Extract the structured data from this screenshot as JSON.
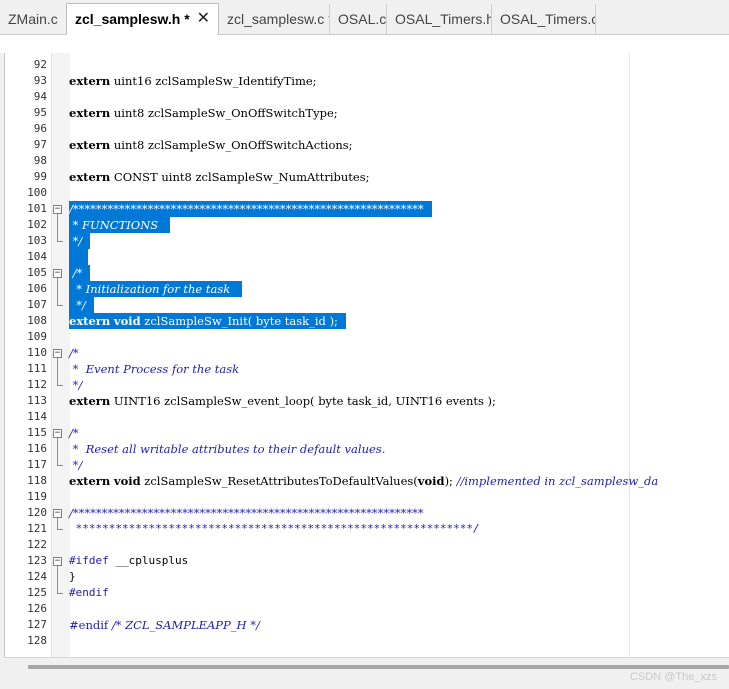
{
  "tabs": [
    {
      "label": "ZMain.c",
      "active": false
    },
    {
      "label": "zcl_samplesw.h *",
      "active": true,
      "close": "✕"
    },
    {
      "label": "zcl_samplesw.c *",
      "active": false
    },
    {
      "label": "OSAL.c",
      "active": false
    },
    {
      "label": "OSAL_Timers.h",
      "active": false
    },
    {
      "label": "OSAL_Timers.c",
      "active": false
    }
  ],
  "lines": [
    {
      "n": "92",
      "text": ""
    },
    {
      "n": "93",
      "text": "extern uint16 zclSampleSw_IdentifyTime;"
    },
    {
      "n": "94",
      "text": ""
    },
    {
      "n": "95",
      "text": "extern uint8 zclSampleSw_OnOffSwitchType;"
    },
    {
      "n": "96",
      "text": ""
    },
    {
      "n": "97",
      "text": "extern uint8 zclSampleSw_OnOffSwitchActions;"
    },
    {
      "n": "98",
      "text": ""
    },
    {
      "n": "99",
      "text": "extern CONST uint8 zclSampleSw_NumAttributes;"
    },
    {
      "n": "100",
      "text": ""
    },
    {
      "n": "101",
      "text": "/*************************************************************"
    },
    {
      "n": "102",
      "text": " * FUNCTIONS "
    },
    {
      "n": "103",
      "text": " */"
    },
    {
      "n": "104",
      "text": ""
    },
    {
      "n": "105",
      "text": " /*"
    },
    {
      "n": "106",
      "text": "  * Initialization for the task "
    },
    {
      "n": "107",
      "text": "  */"
    },
    {
      "n": "108",
      "text": "extern void zclSampleSw_Init( byte task_id );"
    },
    {
      "n": "109",
      "text": ""
    },
    {
      "n": "110",
      "text": "/*"
    },
    {
      "n": "111",
      "text": " *  Event Process for the task"
    },
    {
      "n": "112",
      "text": " */"
    },
    {
      "n": "113",
      "text": "extern UINT16 zclSampleSw_event_loop( byte task_id, UINT16 events );"
    },
    {
      "n": "114",
      "text": ""
    },
    {
      "n": "115",
      "text": "/*"
    },
    {
      "n": "116",
      "text": " *  Reset all writable attributes to their default values."
    },
    {
      "n": "117",
      "text": " */"
    },
    {
      "n": "118",
      "text": "extern void zclSampleSw_ResetAttributesToDefaultValues(void); //implemented in zcl_samplesw_da"
    },
    {
      "n": "119",
      "text": ""
    },
    {
      "n": "120",
      "text": "/*************************************************************"
    },
    {
      "n": "121",
      "text": " ************************************************************/"
    },
    {
      "n": "122",
      "text": ""
    },
    {
      "n": "123",
      "text": "#ifdef __cplusplus"
    },
    {
      "n": "124",
      "text": "}"
    },
    {
      "n": "125",
      "text": "#endif"
    },
    {
      "n": "126",
      "text": ""
    },
    {
      "n": "127",
      "text": "#endif /* ZCL_SAMPLEAPP_H */"
    },
    {
      "n": "128",
      "text": ""
    }
  ],
  "watermark": "CSDN @The_xzs",
  "colors": {
    "selection": "#0078d7",
    "comment": "#1c1cb8",
    "background": "#ffffff"
  }
}
